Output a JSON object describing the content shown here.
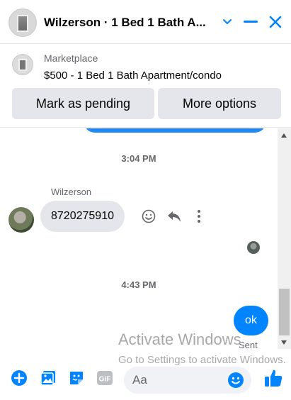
{
  "header": {
    "title": "Wilzerson · 1 Bed 1 Bath A...",
    "icons": [
      "chevron-down-icon",
      "minimize-icon",
      "close-icon"
    ]
  },
  "marketplace": {
    "label": "Marketplace",
    "item": "$500 - 1 Bed 1 Bath Apartment/condo",
    "mark_pending_label": "Mark as pending",
    "more_options_label": "More options"
  },
  "conversation": {
    "timestamp_1": "3:04 PM",
    "sender_name": "Wilzerson",
    "received_message": "8720275910",
    "timestamp_2": "4:43 PM",
    "sent_message": "ok",
    "sent_status": "Sent"
  },
  "watermark": {
    "title": "Activate Windows",
    "subtitle": "Go to Settings to activate Windows."
  },
  "composer": {
    "placeholder": "Aa"
  },
  "colors": {
    "accent": "#0084ff",
    "bubble_gray": "#e4e6eb",
    "muted_text": "#65676b"
  }
}
